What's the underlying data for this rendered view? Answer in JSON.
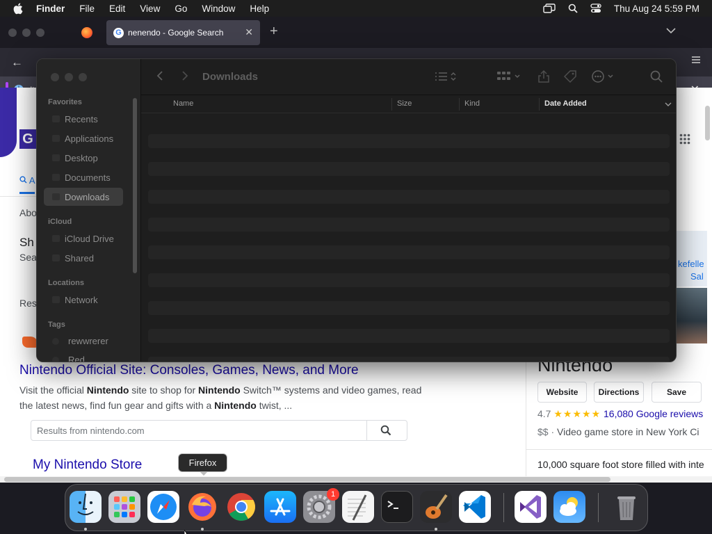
{
  "menubar": {
    "app_name": "Finder",
    "items": [
      "File",
      "Edit",
      "View",
      "Go",
      "Window",
      "Help"
    ],
    "datetime": "Thu Aug 24  5:59 PM"
  },
  "firefox": {
    "active_tab_title": "nenendo - Google Search",
    "infobar_text": "It"
  },
  "google": {
    "tab_all": "A",
    "fragment_about": "Abo",
    "fragment_sh": "Sh",
    "fragment_sea": "Sea",
    "fragment_res": "Res",
    "result": {
      "title": "Nintendo Official Site: Consoles, Games, News, and More",
      "snippet_parts": [
        "Visit the official ",
        "Nintendo",
        " site to shop for ",
        "Nintendo",
        " Switch™ systems and video games, read the latest news, find fun gear and gifts with a ",
        "Nintendo",
        " twist, ..."
      ],
      "site_search_placeholder": "Results from nintendo.com",
      "sub_link": "My Nintendo Store"
    },
    "knowledge_panel": {
      "title": "Nintendo",
      "buttons": [
        "Website",
        "Directions",
        "Save"
      ],
      "rating": "4.7",
      "stars": "★★★★★",
      "reviews": "16,080 Google reviews",
      "price": "$$",
      "category": "Video game store in New York Ci",
      "description": "10,000 square foot store filled with inte",
      "map_label_1": "kefelle",
      "map_label_2": "Sal"
    }
  },
  "finder": {
    "title": "Downloads",
    "sidebar": {
      "favorites_header": "Favorites",
      "favorites": [
        "Recents",
        "Applications",
        "Desktop",
        "Documents",
        "Downloads"
      ],
      "icloud_header": "iCloud",
      "icloud": [
        "iCloud Drive",
        "Shared"
      ],
      "locations_header": "Locations",
      "locations": [
        "Network"
      ],
      "tags_header": "Tags",
      "tags": [
        "rewwrerer",
        "Red"
      ]
    },
    "columns": [
      "Name",
      "Size",
      "Kind",
      "Date Added"
    ],
    "sorted_column": "Date Added"
  },
  "dock": {
    "tooltip": "Firefox",
    "apps": [
      "Finder",
      "Launchpad",
      "Safari",
      "Firefox",
      "Google Chrome",
      "App Store",
      "System Settings",
      "TextEdit",
      "Terminal",
      "GarageBand",
      "Visual Studio Code",
      "Visual Studio",
      "Weather",
      "Trash"
    ],
    "settings_badge": "1"
  }
}
